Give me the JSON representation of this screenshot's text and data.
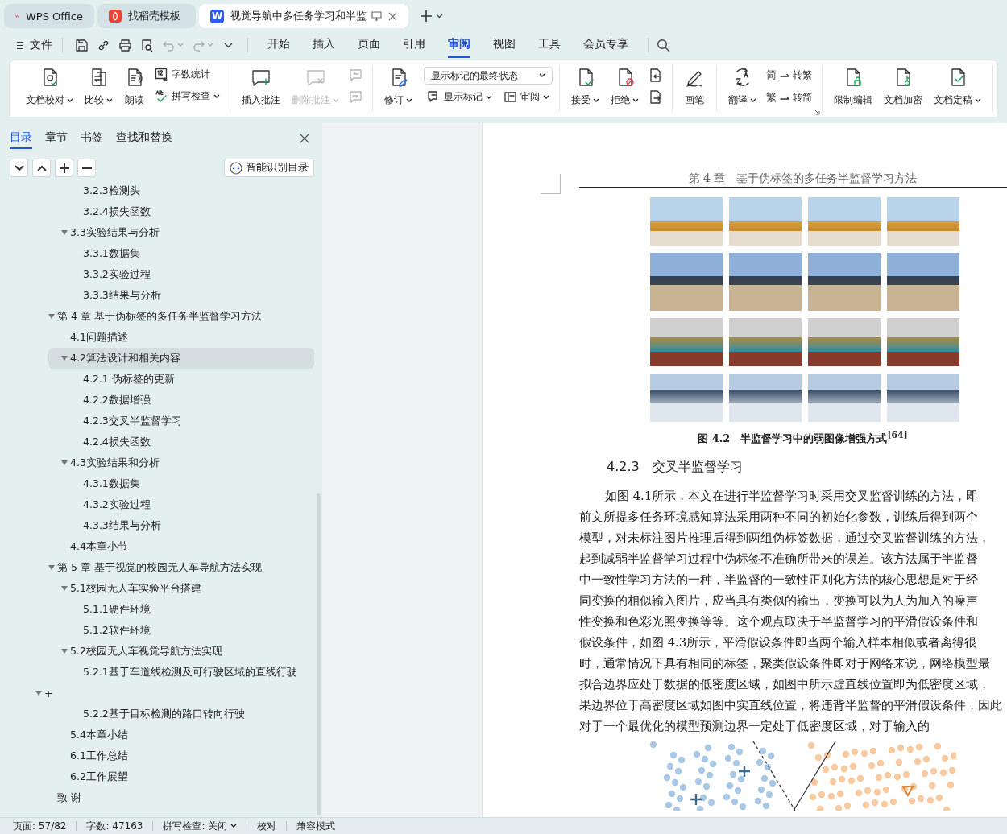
{
  "browser_tabs": [
    {
      "label": "WPS Office",
      "selected": false
    },
    {
      "label": "找稻壳模板",
      "selected": false
    },
    {
      "label": "视觉导航中多任务学习和半监",
      "selected": true,
      "logo_text": "W"
    }
  ],
  "menu": {
    "file_label": "文件",
    "quick_access": [
      {
        "disabled": false,
        "dropdown": false
      },
      {
        "disabled": false,
        "dropdown": false
      },
      {
        "disabled": false,
        "dropdown": false
      },
      {
        "disabled": false,
        "dropdown": false
      },
      {
        "disabled": true,
        "dropdown": true
      },
      {
        "disabled": true,
        "dropdown": true
      },
      {
        "disabled": false,
        "dropdown": false
      }
    ],
    "tabs": [
      {
        "label": "开始",
        "selected": false
      },
      {
        "label": "插入",
        "selected": false
      },
      {
        "label": "页面",
        "selected": false
      },
      {
        "label": "引用",
        "selected": false
      },
      {
        "label": "审阅",
        "selected": true
      },
      {
        "label": "视图",
        "selected": false
      },
      {
        "label": "工具",
        "selected": false
      },
      {
        "label": "会员专享",
        "selected": false
      }
    ]
  },
  "ribbon": [
    {
      "items": [
        {
          "kind": "large",
          "label": "文档校对",
          "dropdown": true,
          "disabled": false
        },
        {
          "kind": "large",
          "label": "比较",
          "dropdown": true,
          "disabled": false
        },
        {
          "kind": "large",
          "label": "朗读",
          "dropdown": false,
          "disabled": false
        },
        {
          "kind": "stack",
          "rows": [
            {
              "label": "字数统计",
              "dropdown": false
            },
            {
              "label": "拼写检查",
              "dropdown": true
            }
          ]
        }
      ]
    },
    {
      "items": [
        {
          "kind": "large",
          "label": "插入批注",
          "dropdown": false,
          "disabled": false
        },
        {
          "kind": "large",
          "label": "删除批注",
          "dropdown": true,
          "disabled": true
        },
        {
          "kind": "icons",
          "buttons": [
            {
              "disabled": true
            },
            {
              "disabled": true
            }
          ]
        }
      ]
    },
    {
      "items": [
        {
          "kind": "large",
          "label": "修订",
          "dropdown": true,
          "disabled": false
        },
        {
          "kind": "select",
          "value": "显示标记的最终状态",
          "rows": [
            {
              "label": "显示标记",
              "dropdown": true
            },
            {
              "label": "审阅",
              "dropdown": true
            }
          ]
        }
      ]
    },
    {
      "items": [
        {
          "kind": "large",
          "label": "接受",
          "dropdown": true,
          "disabled": false
        },
        {
          "kind": "large",
          "label": "拒绝",
          "dropdown": true,
          "disabled": false
        },
        {
          "kind": "icons",
          "buttons": [
            {
              "disabled": false
            },
            {
              "disabled": false
            }
          ]
        }
      ]
    },
    {
      "items": [
        {
          "kind": "large",
          "label": "画笔",
          "dropdown": false,
          "disabled": false
        }
      ]
    },
    {
      "items": [
        {
          "kind": "large",
          "label": "翻译",
          "dropdown": true,
          "disabled": false
        },
        {
          "kind": "stack",
          "rows": [
            {
              "label": "转繁",
              "glyph": "简",
              "dropdown": false
            },
            {
              "label": "转简",
              "glyph": "繁",
              "dropdown": false
            }
          ]
        },
        {
          "kind": "launcher"
        }
      ]
    },
    {
      "items": [
        {
          "kind": "large",
          "label": "限制编辑",
          "dropdown": false,
          "disabled": false
        },
        {
          "kind": "large",
          "label": "文档加密",
          "dropdown": false,
          "disabled": false
        },
        {
          "kind": "large",
          "label": "文档定稿",
          "dropdown": true,
          "disabled": false
        }
      ]
    }
  ],
  "sidebar": {
    "tabs": [
      {
        "label": "目录",
        "selected": true
      },
      {
        "label": "章节",
        "selected": false
      },
      {
        "label": "书签",
        "selected": false
      },
      {
        "label": "查找和替换",
        "selected": false
      }
    ],
    "smart_toc_button": "智能识别目录",
    "toc": [
      {
        "children": [
          {
            "children": [
              {
                "children": [
                  {
                    "label": "3.2.3检测头",
                    "selected": false
                  },
                  {
                    "label": "3.2.4损失函数",
                    "selected": false
                  }
                ]
              },
              {
                "label": "3.3实验结果与分析",
                "selected": false,
                "expanded": true,
                "children": [
                  {
                    "label": "3.3.1数据集",
                    "selected": false
                  },
                  {
                    "label": "3.3.2实验过程",
                    "selected": false
                  },
                  {
                    "label": "3.3.3结果与分析",
                    "selected": false
                  }
                ]
              }
            ]
          },
          {
            "label": "第 4 章  基于伪标签的多任务半监督学习方法",
            "selected": false,
            "expanded": true,
            "children": [
              {
                "label": "4.1问题描述",
                "selected": false
              },
              {
                "label": "4.2算法设计和相关内容",
                "selected": true,
                "expanded": true,
                "children": [
                  {
                    "label": "4.2.1  伪标签的更新",
                    "selected": false
                  },
                  {
                    "label": "4.2.2数据增强",
                    "selected": false
                  },
                  {
                    "label": "4.2.3交叉半监督学习",
                    "selected": false
                  },
                  {
                    "label": "4.2.4损失函数",
                    "selected": false
                  }
                ]
              },
              {
                "label": "4.3实验结果和分析",
                "selected": false,
                "expanded": true,
                "children": [
                  {
                    "label": "4.3.1数据集",
                    "selected": false
                  },
                  {
                    "label": "4.3.2实验过程",
                    "selected": false
                  },
                  {
                    "label": "4.3.3结果与分析",
                    "selected": false
                  }
                ]
              },
              {
                "label": "4.4本章小节",
                "selected": false
              }
            ]
          },
          {
            "label": "第 5 章  基于视觉的校园无人车导航方法实现",
            "selected": false,
            "expanded": true,
            "children": [
              {
                "label": "5.1校园无人车实验平台搭建",
                "selected": false,
                "expanded": true,
                "children": [
                  {
                    "label": "5.1.1硬件环境",
                    "selected": false
                  },
                  {
                    "label": "5.1.2软件环境",
                    "selected": false
                  }
                ]
              },
              {
                "label": "5.2校园无人车视觉导航方法实现",
                "selected": false,
                "expanded": true,
                "children": [
                  {
                    "label": "5.2.1基于车道线检测及可行驶区域的直线行驶",
                    "selected": false
                  }
                ]
              }
            ]
          }
        ]
      },
      {
        "label": "+",
        "selected": false,
        "expanded": true,
        "children": [
          {
            "children": [
              {
                "children": [
                  {
                    "label": "5.2.2基于目标检测的路口转向行驶",
                    "selected": false
                  }
                ]
              },
              {
                "label": "5.4本章小结",
                "selected": false
              },
              {
                "label": "6.1工作总结",
                "selected": false
              },
              {
                "label": "6.2工作展望",
                "selected": false
              }
            ]
          },
          {
            "label": "致 谢",
            "selected": false
          }
        ]
      }
    ]
  },
  "document": {
    "running_head": "第 4 章　基于伪标签的多任务半监督学习方法",
    "figure_caption": "图 4.2　半监督学习中的弱图像增强方式$^{[64]}$",
    "section_heading": "4.2.3　交叉半监督学习",
    "paragraph_lines": [
      "如图 4.1所示，本文在进行半监督学习时采用交叉监督训练的方法，即",
      "前文所提多任务环境感知算法采用两种不同的初始化参数，训练后得到两个",
      "模型，对未标注图片推理后得到两组伪标签数据，通过交叉监督训练的方法，",
      "起到减弱半监督学习过程中伪标签不准确所带来的误差。该方法属于半监督",
      "中一致性学习方法的一种，半监督的一致性正则化方法的核心思想是对于经",
      "同变换的相似输入图片，应当具有类似的输出，变换可以为人为加入的噪声",
      "性变换和色彩光照变换等等。这个观点取决于半监督学习的平滑假设条件和",
      "假设条件，如图 4.3所示，平滑假设条件即当两个输入样本相似或者离得很",
      "时，通常情况下具有相同的标签，聚类假设条件即对于网络来说，网络模型最",
      "拟合边界应处于数据的低密度区域，如图中所示虚直线位置即为低密度区域，",
      "果边界位于高密度区域如图中实直线位置，将违背半监督的平滑假设条件，因此",
      "对于一个最优化的模型预测边界一定处于低密度区域，对于输入的"
    ]
  },
  "status_bar": [
    {
      "label": "页面: 57/82",
      "dropdown": false
    },
    {
      "label": "字数: 47163",
      "dropdown": false
    },
    {
      "label": "拼写检查: 关闭",
      "dropdown": true
    },
    {
      "label": "校对",
      "dropdown": false
    },
    {
      "label": "兼容模式",
      "dropdown": false
    }
  ]
}
